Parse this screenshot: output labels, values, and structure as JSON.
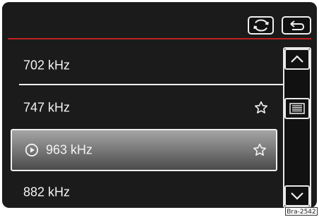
{
  "topbar": {
    "buttons": [
      {
        "icon": "refresh-icon"
      },
      {
        "icon": "back-icon"
      }
    ]
  },
  "list": {
    "items": [
      {
        "label": "702 kHz",
        "favorite": false,
        "playing": false
      },
      {
        "label": "747 kHz",
        "favorite": true,
        "playing": false
      },
      {
        "label": "963 kHz",
        "favorite": true,
        "playing": true
      },
      {
        "label": "882 kHz",
        "favorite": false,
        "playing": false
      }
    ]
  },
  "scroll": {
    "up_icon": "chevron-up-icon",
    "handle_icon": "scroll-handle-icon",
    "down_icon": "chevron-down-icon"
  },
  "watermark": "Bra-2542",
  "colors": {
    "accent_red": "#c02020",
    "background": "#1b1b1b",
    "foreground": "#f3f3f3"
  }
}
